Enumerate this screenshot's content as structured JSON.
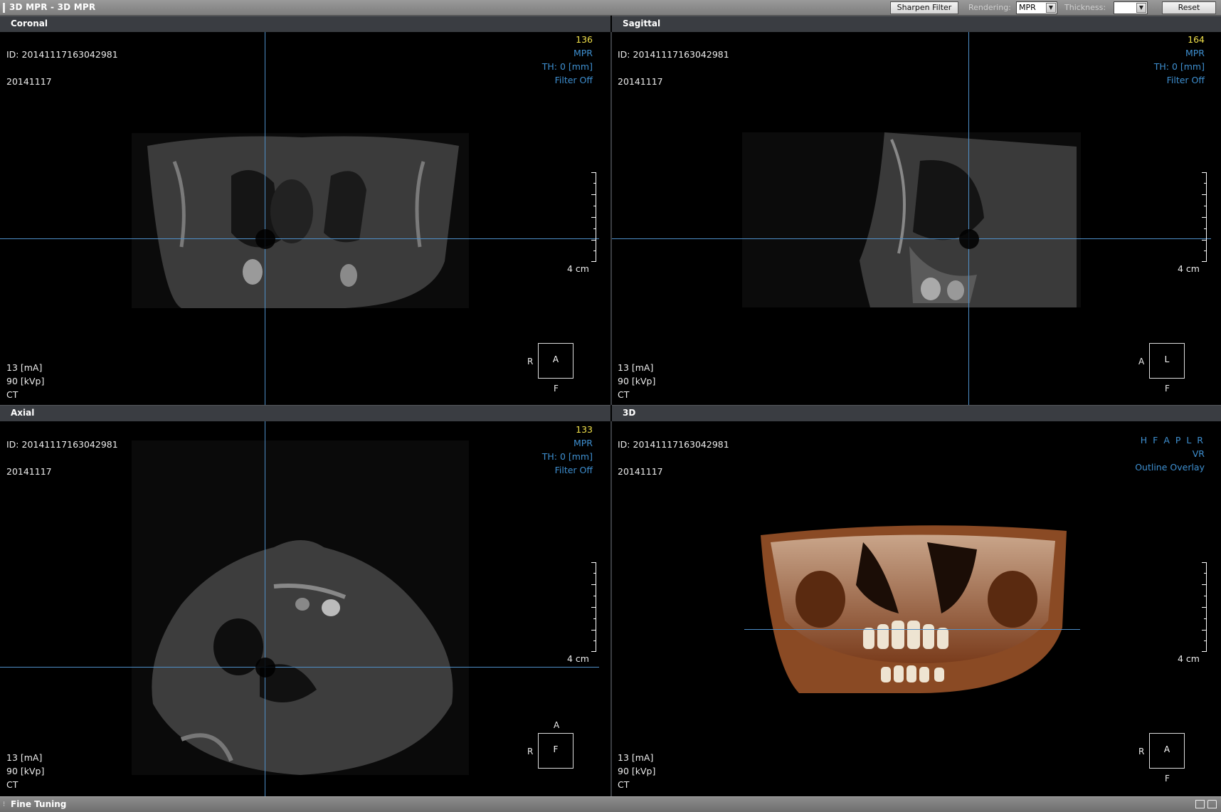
{
  "window": {
    "title": "3D MPR - 3D MPR"
  },
  "toolbar": {
    "sharpen_label": "Sharpen Filter",
    "rendering_label": "Rendering:",
    "rendering_value": "MPR",
    "thickness_label": "Thickness:",
    "thickness_value": "",
    "reset_label": "Reset"
  },
  "panes": {
    "coronal": {
      "title": "Coronal",
      "slice": "136",
      "id": "ID: 20141117163042981",
      "date": "20141117",
      "mode": "MPR",
      "thickness": "TH: 0 [mm]",
      "filter": "Filter Off",
      "ma": "13 [mA]",
      "kvp": "90 [kVp]",
      "modality": "CT",
      "scale": "4 cm",
      "orient_center": "A",
      "orient_left": "R",
      "orient_bottom": "F",
      "orient_top": ""
    },
    "sagittal": {
      "title": "Sagittal",
      "slice": "164",
      "id": "ID: 20141117163042981",
      "date": "20141117",
      "mode": "MPR",
      "thickness": "TH: 0 [mm]",
      "filter": "Filter Off",
      "ma": "13 [mA]",
      "kvp": "90 [kVp]",
      "modality": "CT",
      "scale": "4 cm",
      "orient_center": "L",
      "orient_left": "A",
      "orient_bottom": "F",
      "orient_top": ""
    },
    "axial": {
      "title": "Axial",
      "slice": "133",
      "id": "ID: 20141117163042981",
      "date": "20141117",
      "mode": "MPR",
      "thickness": "TH: 0 [mm]",
      "filter": "Filter Off",
      "ma": "13 [mA]",
      "kvp": "90 [kVp]",
      "modality": "CT",
      "scale": "4 cm",
      "orient_center": "F",
      "orient_left": "R",
      "orient_bottom": "",
      "orient_top": "A"
    },
    "three_d": {
      "title": "3D",
      "id": "ID: 20141117163042981",
      "date": "20141117",
      "view_dirs": "H F A P L R",
      "render_mode": "VR",
      "overlay": "Outline Overlay",
      "ma": "13 [mA]",
      "kvp": "90 [kVp]",
      "modality": "CT",
      "scale": "4 cm",
      "orient_center": "A",
      "orient_left": "R",
      "orient_bottom": "F"
    }
  },
  "footer": {
    "title": "Fine Tuning"
  },
  "colors": {
    "accent_blue": "#3e8fd0",
    "slice_yellow": "#f0e04a",
    "crosshair": "#4f8fc8"
  }
}
